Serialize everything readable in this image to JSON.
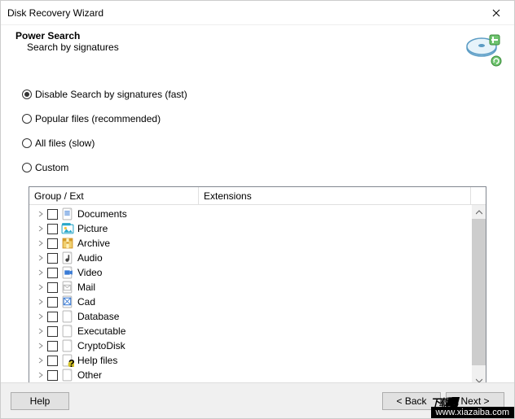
{
  "window": {
    "title": "Disk Recovery Wizard"
  },
  "header": {
    "title": "Power Search",
    "subtitle": "Search by signatures"
  },
  "radios": [
    {
      "label": "Disable Search by signatures (fast)",
      "checked": true
    },
    {
      "label": "Popular files (recommended)",
      "checked": false
    },
    {
      "label": "All files (slow)",
      "checked": false
    },
    {
      "label": "Custom",
      "checked": false
    }
  ],
  "treeHeaders": {
    "group": "Group / Ext",
    "ext": "Extensions"
  },
  "treeRows": [
    {
      "label": "Documents",
      "icon": "doc",
      "color": "#3a7bd5"
    },
    {
      "label": "Picture",
      "icon": "pic",
      "color": "#2aa7c9"
    },
    {
      "label": "Archive",
      "icon": "arc",
      "color": "#d49a2a"
    },
    {
      "label": "Audio",
      "icon": "aud",
      "color": "#444"
    },
    {
      "label": "Video",
      "icon": "vid",
      "color": "#3a7bd5"
    },
    {
      "label": "Mail",
      "icon": "mail",
      "color": "#ccc"
    },
    {
      "label": "Cad",
      "icon": "cad",
      "color": "#3a7bd5"
    },
    {
      "label": "Database",
      "icon": "db",
      "color": "#ccc"
    },
    {
      "label": "Executable",
      "icon": "exe",
      "color": "#ccc"
    },
    {
      "label": "CryptoDisk",
      "icon": "crypt",
      "color": "#ccc"
    },
    {
      "label": "Help files",
      "icon": "help",
      "color": "#d4c32a"
    },
    {
      "label": "Other",
      "icon": "other",
      "color": "#ccc"
    }
  ],
  "buttons": {
    "help": "Help",
    "back": "< Back",
    "next": "Next >"
  },
  "watermark": {
    "text1": "下载",
    "text2": "吧",
    "url": "www.xiazaiba.com"
  }
}
